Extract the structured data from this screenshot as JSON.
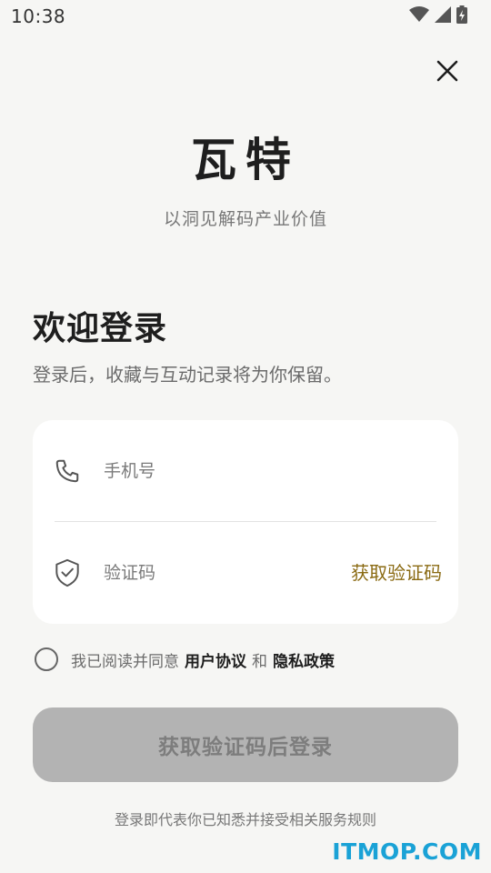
{
  "status_bar": {
    "time": "10:38",
    "icons": [
      "wifi-icon",
      "signal-icon",
      "battery-charging-icon"
    ]
  },
  "header": {
    "close_icon": "close-icon",
    "brand": "瓦特",
    "slogan": "以洞见解码产业价值"
  },
  "welcome": {
    "title": "欢迎登录",
    "subtitle": "登录后，收藏与互动记录将为你保留。"
  },
  "form": {
    "phone": {
      "icon": "phone-icon",
      "placeholder": "手机号",
      "value": ""
    },
    "code": {
      "icon": "shield-check-icon",
      "placeholder": "验证码",
      "value": "",
      "get_code_label": "获取验证码"
    }
  },
  "agreement": {
    "checked": false,
    "prefix": "我已阅读并同意",
    "user_agreement": "用户协议",
    "and": "和",
    "privacy_policy": "隐私政策"
  },
  "login_button": {
    "label": "获取验证码后登录",
    "enabled": false
  },
  "footer": {
    "note": "登录即代表你已知悉并接受相关服务规则"
  },
  "watermark": {
    "text": "ITMOP.COM"
  },
  "colors": {
    "background": "#f6f6f4",
    "card": "#ffffff",
    "accent_gold": "#8a6a12",
    "button_disabled": "#b3b3b3",
    "watermark": "#1aa2d6"
  }
}
